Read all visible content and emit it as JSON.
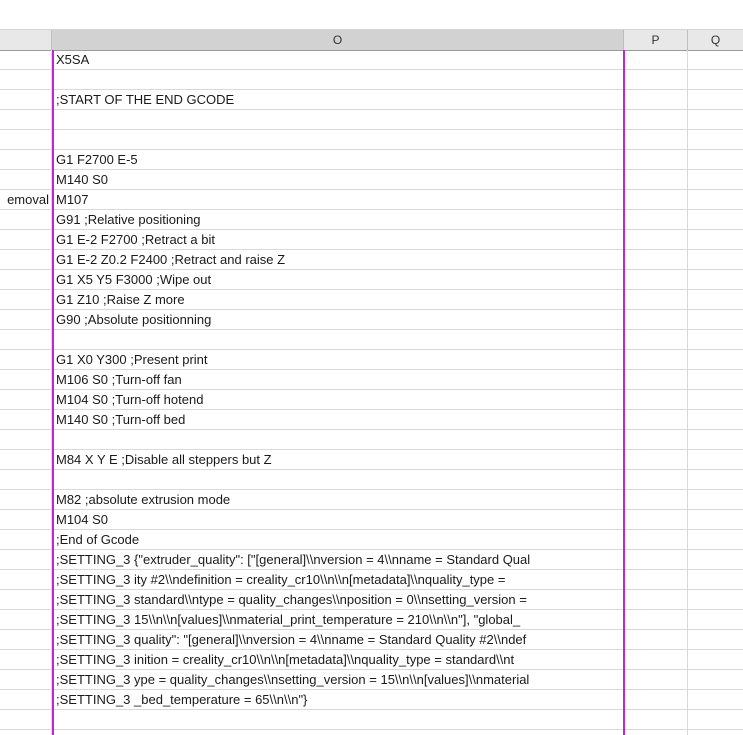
{
  "columns": {
    "o": "O",
    "p": "P",
    "q": "Q"
  },
  "selection_color": "#c026d3",
  "rows": [
    {
      "n": "",
      "o": "X5SA"
    },
    {
      "n": "",
      "o": ""
    },
    {
      "n": "",
      "o": ";START OF THE END GCODE"
    },
    {
      "n": "",
      "o": ""
    },
    {
      "n": "",
      "o": ""
    },
    {
      "n": "",
      "o": "G1 F2700 E-5"
    },
    {
      "n": "",
      "o": "M140 S0"
    },
    {
      "n": "emoval",
      "o": "M107"
    },
    {
      "n": "",
      "o": "G91 ;Relative positioning"
    },
    {
      "n": "",
      "o": "G1 E-2 F2700 ;Retract a bit"
    },
    {
      "n": "",
      "o": "G1 E-2 Z0.2 F2400 ;Retract and raise Z"
    },
    {
      "n": "",
      "o": "G1 X5 Y5 F3000 ;Wipe out"
    },
    {
      "n": "",
      "o": "G1 Z10 ;Raise Z more"
    },
    {
      "n": "",
      "o": "G90 ;Absolute positionning"
    },
    {
      "n": "",
      "o": ""
    },
    {
      "n": "",
      "o": "G1 X0 Y300 ;Present print"
    },
    {
      "n": "",
      "o": "M106 S0 ;Turn-off fan"
    },
    {
      "n": "",
      "o": "M104 S0 ;Turn-off hotend"
    },
    {
      "n": "",
      "o": "M140 S0 ;Turn-off bed"
    },
    {
      "n": "",
      "o": ""
    },
    {
      "n": "",
      "o": "M84 X Y E ;Disable all steppers but Z"
    },
    {
      "n": "",
      "o": ""
    },
    {
      "n": "",
      "o": "M82 ;absolute extrusion mode"
    },
    {
      "n": "",
      "o": "M104 S0"
    },
    {
      "n": "",
      "o": ";End of Gcode"
    },
    {
      "n": "",
      "o": ";SETTING_3 {\"extruder_quality\": [\"[general]\\\\nversion = 4\\\\nname = Standard Qual"
    },
    {
      "n": "",
      "o": ";SETTING_3 ity #2\\\\ndefinition = creality_cr10\\\\n\\\\n[metadata]\\\\nquality_type ="
    },
    {
      "n": "",
      "o": ";SETTING_3 standard\\\\ntype = quality_changes\\\\nposition = 0\\\\nsetting_version ="
    },
    {
      "n": "",
      "o": ";SETTING_3 15\\\\n\\\\n[values]\\\\nmaterial_print_temperature = 210\\\\n\\\\n\"], \"global_"
    },
    {
      "n": "",
      "o": ";SETTING_3 quality\": \"[general]\\\\nversion = 4\\\\nname = Standard Quality #2\\\\ndef"
    },
    {
      "n": "",
      "o": ";SETTING_3 inition = creality_cr10\\\\n\\\\n[metadata]\\\\nquality_type = standard\\\\nt"
    },
    {
      "n": "",
      "o": ";SETTING_3 ype = quality_changes\\\\nsetting_version = 15\\\\n\\\\n[values]\\\\nmaterial"
    },
    {
      "n": "",
      "o": ";SETTING_3 _bed_temperature = 65\\\\n\\\\n\"}"
    },
    {
      "n": "",
      "o": ""
    },
    {
      "n": "",
      "o": ""
    }
  ]
}
